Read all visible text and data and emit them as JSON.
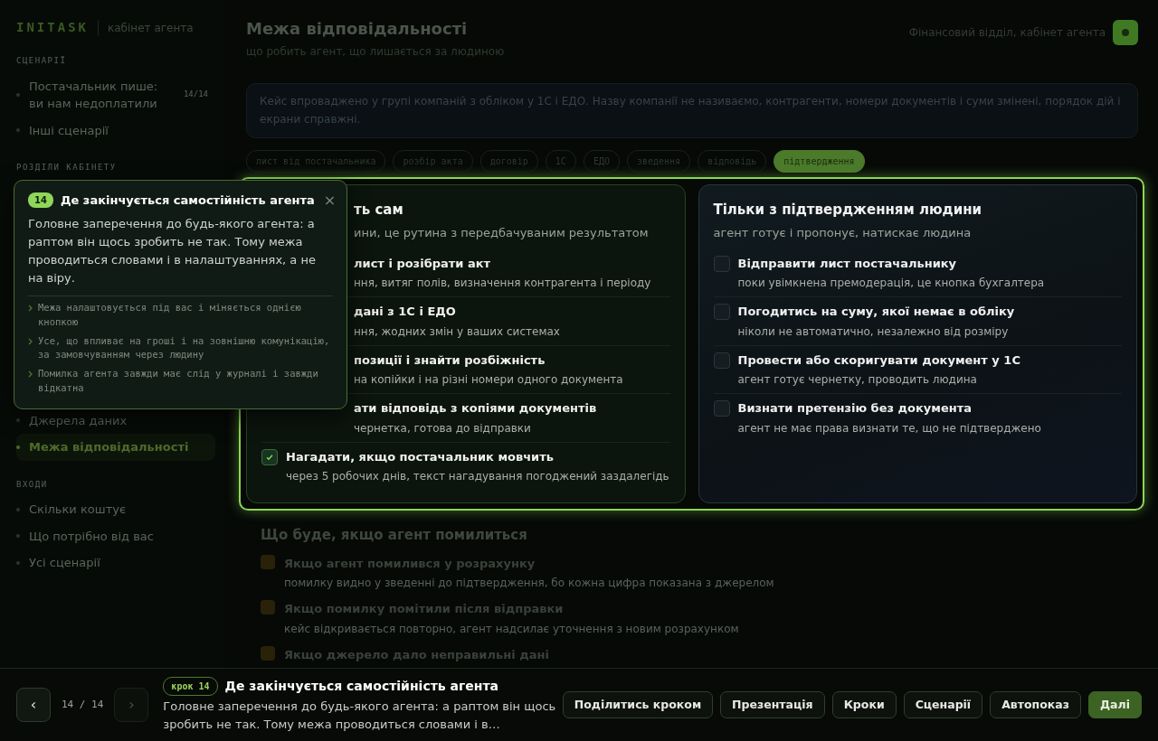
{
  "brand": {
    "logo": "INITASK",
    "subtitle": "кабінет агента"
  },
  "sidebar": {
    "sections": [
      {
        "label": "СЦЕНАРІЇ",
        "items": [
          {
            "label": "Постачальник пише: ви нам недоплатили",
            "count": "14/14",
            "selected": false
          },
          {
            "label": "Інші сценарії",
            "selected": false
          }
        ]
      },
      {
        "label": "РОЗДІЛИ КАБІНЕТУ",
        "items": [
          {
            "label": "Джерела даних",
            "selected": false
          },
          {
            "label": "Межа відповідальності",
            "selected": true
          }
        ]
      },
      {
        "label": "ВХОДИ",
        "items": [
          {
            "label": "Скільки коштує",
            "selected": false
          },
          {
            "label": "Що потрібно від вас",
            "selected": false
          },
          {
            "label": "Усі сценарії",
            "selected": false
          }
        ]
      }
    ]
  },
  "page": {
    "title": "Межа відповідальності",
    "subtitle": "що робить агент, що лишається за людиною"
  },
  "account": {
    "label": "Фінансовий відділ, кабінет агента"
  },
  "note": "Кейс впроваджено у групі компаній з обліком у 1С і ЕДО. Назву компанії не називаємо, контрагенти, номери документів і суми змінені, порядок дій і екрани справжні.",
  "tags": [
    {
      "label": "лист від постачальника",
      "selected": false
    },
    {
      "label": "розбір акта",
      "selected": false
    },
    {
      "label": "договір",
      "selected": false
    },
    {
      "label": "1С",
      "selected": false
    },
    {
      "label": "ЕДО",
      "selected": false
    },
    {
      "label": "зведення",
      "selected": false
    },
    {
      "label": "відповідь",
      "selected": false
    },
    {
      "label": "підтвердження",
      "selected": true
    }
  ],
  "cards": [
    {
      "kind": "auto",
      "title": "ть сам",
      "subtitle": "ини, це рутина з передбачуваним результатом",
      "partly_hidden": true,
      "items": [
        {
          "title": "лист і розібрати акт",
          "text": "ння, витяг полів, визначення контрагента і періоду",
          "partly_hidden": true
        },
        {
          "title": "дані з 1С і ЕДО",
          "text": "ння, жодних змін у ваших системах",
          "partly_hidden": true
        },
        {
          "title": "позиції і знайти розбіжність",
          "text": "на копійки і на різні номери одного документа",
          "partly_hidden": true
        },
        {
          "title": "ати відповідь з копіями документів",
          "text": "чернетка, готова до відправки",
          "partly_hidden": true
        },
        {
          "title": "Нагадати, якщо постачальник мовчить",
          "text": "через 5 робочих днів, текст нагадування погоджений заздалегідь",
          "checked": true
        }
      ]
    },
    {
      "kind": "human",
      "title": "Тільки з підтвердженням людини",
      "subtitle": "агент готує і пропонує, натискає людина",
      "items": [
        {
          "title": "Відправити лист постачальнику",
          "text": "поки увімкнена премодерація, це кнопка бухгалтера",
          "checked": false
        },
        {
          "title": "Погодитись на суму, якої немає в обліку",
          "text": "ніколи не автоматично, незалежно від розміру",
          "checked": false
        },
        {
          "title": "Провести або скоригувати документ у 1С",
          "text": "агент готує чернетку, проводить людина",
          "checked": false
        },
        {
          "title": "Визнати претензію без документа",
          "text": "агент не має права визнати те, що не підтверджено",
          "checked": false
        }
      ]
    }
  ],
  "risks": {
    "title": "Що буде, якщо агент помилиться",
    "items": [
      {
        "title": "Якщо агент помилився у розрахунку",
        "text": "помилку видно у зведенні до підтвердження, бо кожна цифра показана з джерелом"
      },
      {
        "title": "Якщо помилку помітили після відправки",
        "text": "кейс відкривається повторно, агент надсилає уточнення з новим розрахунком"
      },
      {
        "title": "Якщо джерело дало неправильні дані"
      }
    ]
  },
  "popover": {
    "badge": "14",
    "title": "Де закінчується самостійність агента",
    "close": "×",
    "text": "Головне заперечення до будь-якого агента: а раптом він щось зробить не так. Тому межа проводиться словами і в налаштуваннях, а не на віру.",
    "bullets": [
      "Межа налаштовується під вас і міняється однією кнопкою",
      "Усе, що впливає на гроші і на зовнішню комунікацію, за замовчуванням через людину",
      "Помилка агента завжди має слід у журналі і завжди відкатна"
    ]
  },
  "tour": {
    "prev": "‹",
    "counter": "14 / 14",
    "next": "›",
    "next_disabled": true,
    "step": "крок 14",
    "title": "Де закінчується самостійність агента",
    "text": "Головне заперечення до будь-якого агента: а раптом він щось зробить не так. Тому межа проводиться словами і в…",
    "actions": [
      {
        "label": "Поділитись кроком",
        "kind": "outline"
      },
      {
        "label": "Презентація",
        "kind": "outline"
      },
      {
        "label": "Кроки",
        "kind": "outline"
      },
      {
        "label": "Сценарії",
        "kind": "outline"
      },
      {
        "label": "Автопоказ",
        "kind": "outline"
      },
      {
        "label": "Далі",
        "kind": "primary"
      }
    ]
  }
}
